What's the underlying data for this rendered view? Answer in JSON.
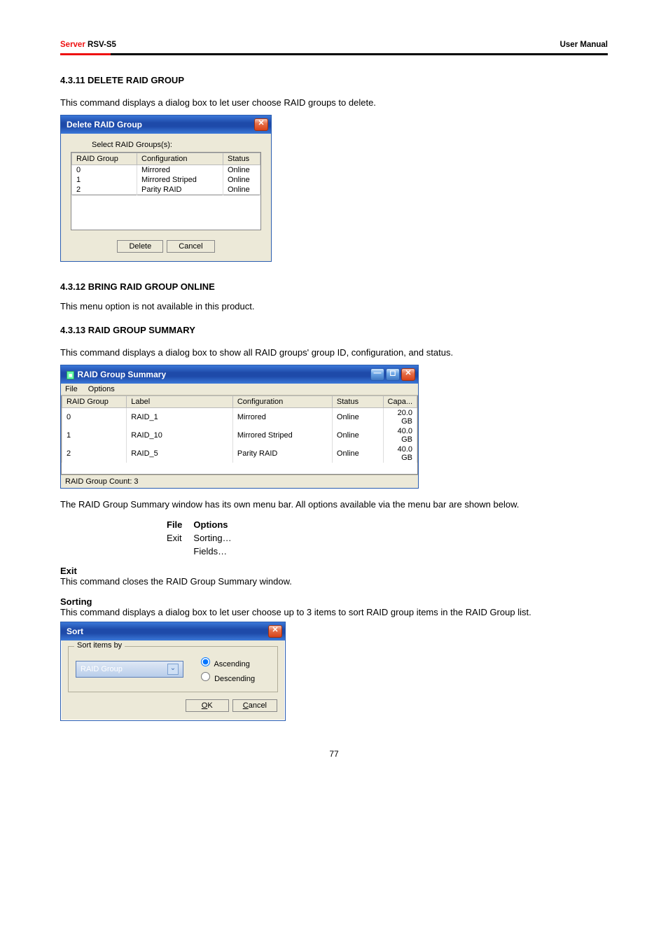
{
  "header": {
    "left_red": "Server",
    "left_black": " RSV-S5",
    "right": "User Manual"
  },
  "sections": {
    "s11_title": "4.3.11 DELETE RAID GROUP",
    "s11_body": "This command displays a dialog box to let user choose RAID groups to delete.",
    "s12_title": "4.3.12 BRING RAID GROUP ONLINE",
    "s12_body": "This menu option is not available in this product.",
    "s13_title": "4.3.13 RAID GROUP SUMMARY",
    "s13_body": "This command displays a dialog box to show all RAID groups' group ID, configuration, and status.",
    "s13_body2": "The RAID Group Summary window has its own menu bar. All options available via the menu bar are shown below."
  },
  "delete_dialog": {
    "title": "Delete RAID Group",
    "subtitle": "Select RAID Groups(s):",
    "headers": {
      "c0": "RAID Group",
      "c1": "Configuration",
      "c2": "Status"
    },
    "rows": [
      {
        "g": "0",
        "cfg": "Mirrored",
        "st": "Online"
      },
      {
        "g": "1",
        "cfg": "Mirrored Striped",
        "st": "Online"
      },
      {
        "g": "2",
        "cfg": "Parity RAID",
        "st": "Online"
      }
    ],
    "btn_delete": "Delete",
    "btn_cancel": "Cancel"
  },
  "summary_dialog": {
    "title": "RAID Group Summary",
    "menu_file": "File",
    "menu_options": "Options",
    "headers": {
      "c0": "RAID Group",
      "c1": "Label",
      "c2": "Configuration",
      "c3": "Status",
      "c4": "Capa..."
    },
    "rows": [
      {
        "g": "0",
        "lbl": "RAID_1",
        "cfg": "Mirrored",
        "st": "Online",
        "cap": "20.0 GB"
      },
      {
        "g": "1",
        "lbl": "RAID_10",
        "cfg": "Mirrored Striped",
        "st": "Online",
        "cap": "40.0 GB"
      },
      {
        "g": "2",
        "lbl": "RAID_5",
        "cfg": "Parity RAID",
        "st": "Online",
        "cap": "40.0 GB"
      }
    ],
    "status": "RAID Group Count: 3"
  },
  "menu_options_table": {
    "hdr_file": "File",
    "hdr_options": "Options",
    "file_exit": "Exit",
    "opt_sorting": "Sorting…",
    "opt_fields": "Fields…"
  },
  "exit_section": {
    "title": "Exit",
    "body": "This command closes the RAID Group Summary window."
  },
  "sorting_section": {
    "title": "Sorting",
    "body": "This command displays a dialog box to let user choose up to 3 items to sort RAID group items in the RAID Group list."
  },
  "sort_dialog": {
    "title": "Sort",
    "groupbox": "Sort items by",
    "combo_value": "RAID Group",
    "radio_asc": "Ascending",
    "radio_desc": "Descending",
    "btn_ok": "OK",
    "btn_cancel": "Cancel"
  },
  "page_number": "77"
}
